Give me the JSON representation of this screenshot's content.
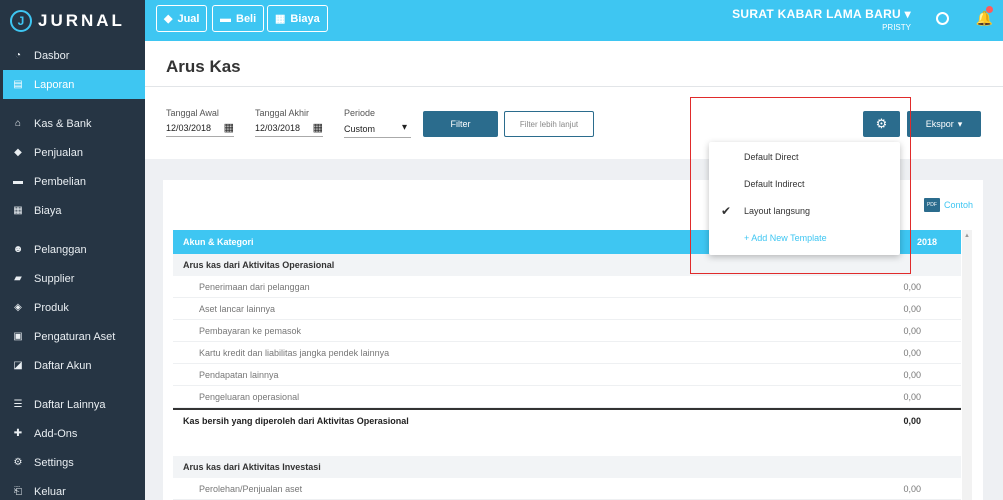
{
  "app": {
    "logo_letter": "J",
    "logo_text": "JURNAL"
  },
  "sidebar": {
    "items": [
      {
        "label": "Dasbor",
        "icon": "dashboard-icon",
        "glyph": "◔"
      },
      {
        "label": "Laporan",
        "icon": "report-icon",
        "glyph": "▤",
        "active": true
      },
      {
        "label": "Kas & Bank",
        "icon": "bank-icon",
        "glyph": "⌂"
      },
      {
        "label": "Penjualan",
        "icon": "tag-icon",
        "glyph": "◆"
      },
      {
        "label": "Pembelian",
        "icon": "card-icon",
        "glyph": "▬"
      },
      {
        "label": "Biaya",
        "icon": "receipt-icon",
        "glyph": "▦"
      },
      {
        "label": "Pelanggan",
        "icon": "users-icon",
        "glyph": "☻"
      },
      {
        "label": "Supplier",
        "icon": "truck-icon",
        "glyph": "▰"
      },
      {
        "label": "Produk",
        "icon": "box-icon",
        "glyph": "◈"
      },
      {
        "label": "Pengaturan Aset",
        "icon": "asset-icon",
        "glyph": "▣"
      },
      {
        "label": "Daftar Akun",
        "icon": "book-icon",
        "glyph": "◪"
      },
      {
        "label": "Daftar Lainnya",
        "icon": "list-icon",
        "glyph": "☰"
      },
      {
        "label": "Add-Ons",
        "icon": "puzzle-icon",
        "glyph": "✚"
      },
      {
        "label": "Settings",
        "icon": "gear-icon",
        "glyph": "⚙"
      },
      {
        "label": "Keluar",
        "icon": "logout-icon",
        "glyph": "⎗"
      }
    ]
  },
  "topbar": {
    "jual": "Jual",
    "beli": "Beli",
    "biaya": "Biaya",
    "company": "SURAT KABAR LAMA BARU",
    "caret": "▾",
    "user": "PRISTY",
    "bell_glyph": "🔔"
  },
  "page": {
    "title": "Arus Kas"
  },
  "filters": {
    "start_label": "Tanggal Awal",
    "start_value": "12/03/2018",
    "end_label": "Tanggal Akhir",
    "end_value": "12/03/2018",
    "period_label": "Periode",
    "period_value": "Custom",
    "filter_button": "Filter",
    "advanced_button": "Filter lebih lanjut",
    "export_button": "Ekspor",
    "caret": "▾",
    "gear_glyph": "⚙",
    "calendar_glyph": "▦"
  },
  "dropdown": {
    "items": [
      "Default Direct",
      "Default Indirect",
      "Layout langsung",
      "+ Add New Template"
    ],
    "checked_index": 2,
    "check_glyph": "✔"
  },
  "report": {
    "example_label": "Contoh",
    "pdf_label": "PDF",
    "col_account": "Akun & Kategori",
    "col_year": "2018",
    "scroll_up_glyph": "▲",
    "rows": [
      {
        "type": "section",
        "label": "Arus kas dari Aktivitas Operasional",
        "value": ""
      },
      {
        "type": "item",
        "label": "Penerimaan dari pelanggan",
        "value": "0,00"
      },
      {
        "type": "item",
        "label": "Aset lancar lainnya",
        "value": "0,00"
      },
      {
        "type": "item",
        "label": "Pembayaran ke pemasok",
        "value": "0,00"
      },
      {
        "type": "item",
        "label": "Kartu kredit dan liabilitas jangka pendek lainnya",
        "value": "0,00"
      },
      {
        "type": "item",
        "label": "Pendapatan lainnya",
        "value": "0,00"
      },
      {
        "type": "item",
        "label": "Pengeluaran operasional",
        "value": "0,00"
      },
      {
        "type": "total",
        "label": "Kas bersih yang diperoleh dari Aktivitas Operasional",
        "value": "0,00"
      },
      {
        "type": "spacer",
        "label": "",
        "value": ""
      },
      {
        "type": "section",
        "label": "Arus kas dari Aktivitas Investasi",
        "value": ""
      },
      {
        "type": "item",
        "label": "Perolehan/Penjualan aset",
        "value": "0,00"
      }
    ]
  }
}
